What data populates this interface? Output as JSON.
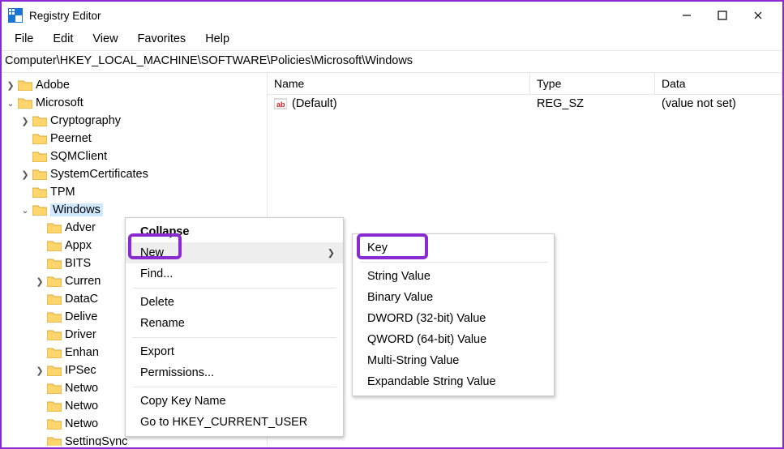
{
  "window": {
    "title": "Registry Editor"
  },
  "menubar": {
    "file": "File",
    "edit": "Edit",
    "view": "View",
    "favorites": "Favorites",
    "help": "Help"
  },
  "address": "Computer\\HKEY_LOCAL_MACHINE\\SOFTWARE\\Policies\\Microsoft\\Windows",
  "tree": {
    "adobe": "Adobe",
    "microsoft": "Microsoft",
    "cryptography": "Cryptography",
    "peernet": "Peernet",
    "sqmclient": "SQMClient",
    "systemcertificates": "SystemCertificates",
    "tpm": "TPM",
    "windows": "Windows",
    "adver": "Adver",
    "appx": "Appx",
    "bits": "BITS",
    "curren": "Curren",
    "datac": "DataC",
    "delive": "Delive",
    "driver": "Driver",
    "enhan": "Enhan",
    "ipsec": "IPSec",
    "netwo1": "Netwo",
    "netwo2": "Netwo",
    "netwo3": "Netwo",
    "settingsync": "SettingSync"
  },
  "list": {
    "headers": {
      "name": "Name",
      "type": "Type",
      "data": "Data"
    },
    "rows": [
      {
        "name": "(Default)",
        "type": "REG_SZ",
        "data": "(value not set)"
      }
    ]
  },
  "ctxmenu": {
    "collapse": "Collapse",
    "new": "New",
    "find": "Find...",
    "delete": "Delete",
    "rename": "Rename",
    "export": "Export",
    "permissions": "Permissions...",
    "copykey": "Copy Key Name",
    "goto": "Go to HKEY_CURRENT_USER"
  },
  "submenu": {
    "key": "Key",
    "string": "String Value",
    "binary": "Binary Value",
    "dword": "DWORD (32-bit) Value",
    "qword": "QWORD (64-bit) Value",
    "multistring": "Multi-String Value",
    "expandable": "Expandable String Value"
  }
}
